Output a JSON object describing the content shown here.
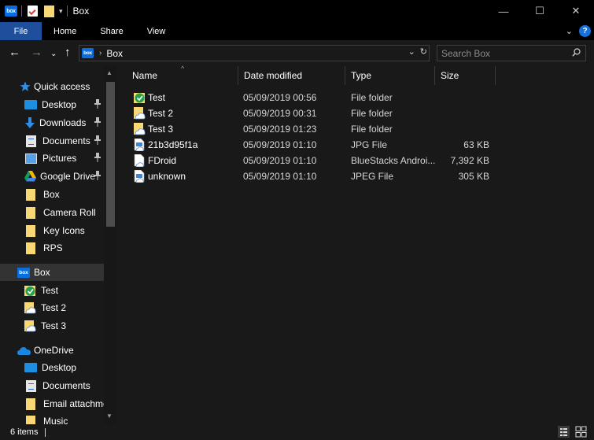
{
  "window": {
    "title": "Box",
    "qat_box_logo": "box",
    "qat_dropdown": "▾",
    "controls": {
      "minimize": "—",
      "maximize": "☐",
      "close": "✕"
    }
  },
  "ribbon": {
    "tabs": [
      "File",
      "Home",
      "Share",
      "View"
    ],
    "expand_chevron": "⌄",
    "help": "?"
  },
  "address": {
    "back": "←",
    "forward": "→",
    "recent": "⌄",
    "up": "↑",
    "logo": "box",
    "separator": "›",
    "crumb": "Box",
    "dropdown": "⌄",
    "refresh": "↻",
    "search_placeholder": "Search Box"
  },
  "nav": {
    "quick_access": "Quick access",
    "quick_items": [
      {
        "label": "Desktop",
        "icon": "desktop-icon",
        "pinned": true
      },
      {
        "label": "Downloads",
        "icon": "download-arrow-icon",
        "pinned": true
      },
      {
        "label": "Documents",
        "icon": "documents-icon",
        "pinned": true
      },
      {
        "label": "Pictures",
        "icon": "pictures-icon",
        "pinned": true
      },
      {
        "label": "Google Drive",
        "icon": "google-drive-icon",
        "pinned": true
      },
      {
        "label": "Box",
        "icon": "folder-icon",
        "pinned": false
      },
      {
        "label": "Camera Roll",
        "icon": "folder-icon",
        "pinned": false
      },
      {
        "label": "Key Icons",
        "icon": "folder-icon",
        "pinned": false
      },
      {
        "label": "RPS",
        "icon": "folder-icon",
        "pinned": false
      }
    ],
    "box_root": {
      "label": "Box",
      "logo": "box"
    },
    "box_items": [
      {
        "label": "Test",
        "icon": "synced-folder-icon"
      },
      {
        "label": "Test 2",
        "icon": "cloud-folder-icon"
      },
      {
        "label": "Test 3",
        "icon": "cloud-folder-icon"
      }
    ],
    "onedrive": "OneDrive",
    "onedrive_items": [
      {
        "label": "Desktop",
        "icon": "desktop-icon"
      },
      {
        "label": "Documents",
        "icon": "documents-icon"
      },
      {
        "label": "Email attachmer",
        "icon": "folder-icon"
      },
      {
        "label": "Music",
        "icon": "folder-icon"
      }
    ]
  },
  "files": {
    "columns": [
      "Name",
      "Date modified",
      "Type",
      "Size"
    ],
    "rows": [
      {
        "name": "Test",
        "date": "05/09/2019 00:56",
        "type": "File folder",
        "size": "",
        "icon": "synced-folder-icon"
      },
      {
        "name": "Test 2",
        "date": "05/09/2019 00:31",
        "type": "File folder",
        "size": "",
        "icon": "cloud-folder-icon"
      },
      {
        "name": "Test 3",
        "date": "05/09/2019 01:23",
        "type": "File folder",
        "size": "",
        "icon": "cloud-folder-icon"
      },
      {
        "name": "21b3d95f1a",
        "date": "05/09/2019 01:10",
        "type": "JPG File",
        "size": "63 KB",
        "icon": "cloud-file-icon"
      },
      {
        "name": "FDroid",
        "date": "05/09/2019 01:10",
        "type": "BlueStacks Androi...",
        "size": "7,392 KB",
        "icon": "cloud-file-icon"
      },
      {
        "name": "unknown",
        "date": "05/09/2019 01:10",
        "type": "JPEG File",
        "size": "305 KB",
        "icon": "cloud-file-icon"
      }
    ]
  },
  "status": {
    "items": "6 items"
  },
  "colors": {
    "background": "#191919",
    "titlebar": "#000000",
    "file_tab": "#1e4e9c",
    "box_blue": "#0a6ee0",
    "folder": "#f8d775",
    "selected": "#333333"
  }
}
